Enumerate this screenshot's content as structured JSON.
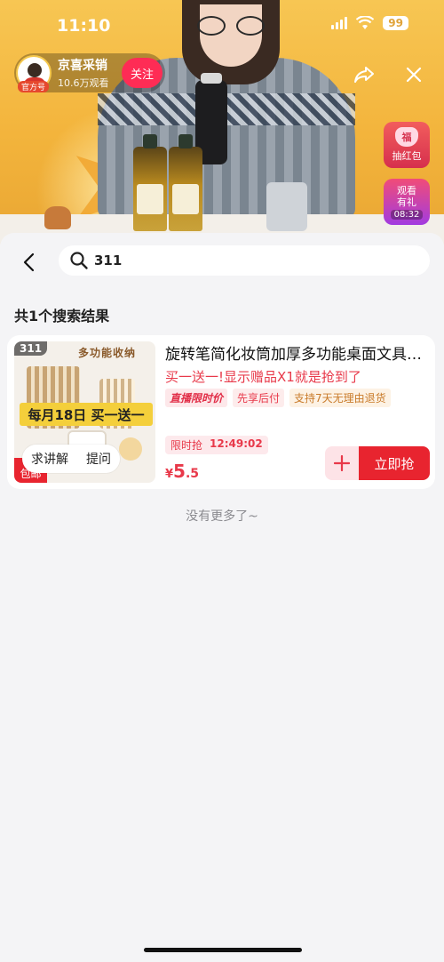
{
  "status_bar": {
    "time": "11:10",
    "battery": "99"
  },
  "live": {
    "host_name": "京喜采销",
    "viewers": "10.6万观看",
    "official_tag": "官方号",
    "follow_label": "关注",
    "side_badges": {
      "redpack_icon_text": "福",
      "redpack_label": "抽红包",
      "gift_title": "观看有礼",
      "gift_timer": "08:32"
    }
  },
  "search": {
    "query": "311"
  },
  "results": {
    "count_label": "共1个搜索结果",
    "items": [
      {
        "number": "311",
        "title": "旋转笔简化妆筒加厚多功能桌面文具收纳",
        "subtitle": "买一送一!显示赠品X1就是抢到了",
        "tags": [
          "直播限时价",
          "先享后付",
          "支持7天无理由退货"
        ],
        "countdown_label": "限时抢",
        "countdown_time": "12:49:02",
        "price_currency": "¥",
        "price_int": "5",
        "price_dec": ".5",
        "thumb_title_art": "多功能收纳",
        "thumb_promo": "每月18日 买一送一",
        "ship_tag": "包邮",
        "explain_label": "求讲解",
        "ask_label": "提问",
        "buy_label": "立即抢"
      }
    ],
    "end_label": "没有更多了~"
  },
  "colors": {
    "accent": "#e8242f",
    "follow": "#fe2c55",
    "price": "#e8394a"
  }
}
